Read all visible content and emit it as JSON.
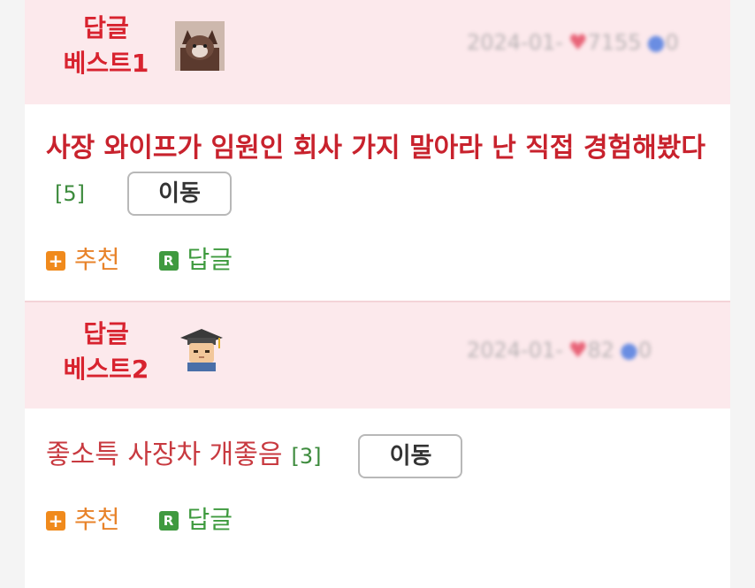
{
  "colors": {
    "header_bg": "#fce9ec",
    "best_label": "#d8232f",
    "title_red": "#c8222d",
    "count_green": "#3d8b3d",
    "recommend_orange": "#f08a1c",
    "reply_green": "#3f9a3f"
  },
  "posts": [
    {
      "best_label_line1": "답글",
      "best_label_line2": "베스트1",
      "avatar": "cat-avatar-icon",
      "meta_date": "2024-01-",
      "meta_hearts": "7155",
      "meta_thumbs": "0",
      "title": "사장 와이프가 임원인 회사 가지 말아라 난 직접 경험해봤다",
      "comment_count": "[5]",
      "move_label": "이동",
      "recommend_label": "추천",
      "reply_label": "답글",
      "recommend_badge": "+",
      "reply_badge": "R"
    },
    {
      "best_label_line1": "답글",
      "best_label_line2": "베스트2",
      "avatar": "graduate-avatar-icon",
      "meta_date": "2024-01-",
      "meta_hearts": "82",
      "meta_thumbs": "0",
      "title": "좋소특 사장차 개좋음",
      "comment_count": "[3]",
      "move_label": "이동",
      "recommend_label": "추천",
      "reply_label": "답글",
      "recommend_badge": "+",
      "reply_badge": "R"
    }
  ]
}
